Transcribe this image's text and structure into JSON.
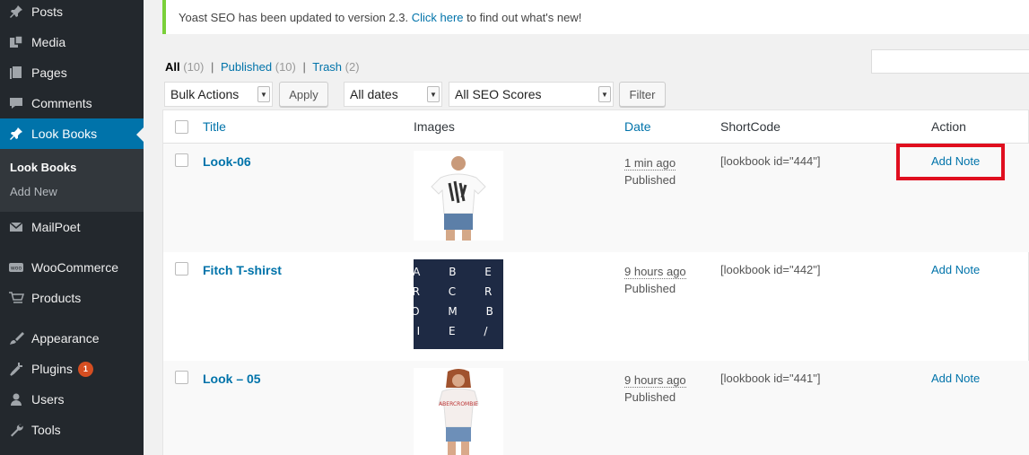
{
  "sidebar": {
    "items": [
      {
        "label": "Posts",
        "icon": "pin-icon"
      },
      {
        "label": "Media",
        "icon": "media-icon"
      },
      {
        "label": "Pages",
        "icon": "pages-icon"
      },
      {
        "label": "Comments",
        "icon": "comment-icon"
      },
      {
        "label": "Look Books",
        "icon": "pin-icon"
      },
      {
        "label": "MailPoet",
        "icon": "mail-icon"
      },
      {
        "label": "WooCommerce",
        "icon": "woo-icon"
      },
      {
        "label": "Products",
        "icon": "cart-icon"
      },
      {
        "label": "Appearance",
        "icon": "brush-icon"
      },
      {
        "label": "Plugins",
        "icon": "plug-icon",
        "badge": "1"
      },
      {
        "label": "Users",
        "icon": "user-icon"
      },
      {
        "label": "Tools",
        "icon": "wrench-icon"
      }
    ],
    "submenu": [
      {
        "label": "Look Books"
      },
      {
        "label": "Add New"
      }
    ],
    "accent": "#0073aa"
  },
  "notice": {
    "prefix": "Yoast SEO has been updated to version 2.3. ",
    "link": "Click here",
    "suffix": " to find out what's new!"
  },
  "views": {
    "all": "All",
    "all_count": "(10)",
    "published": "Published",
    "published_count": "(10)",
    "trash": "Trash",
    "trash_count": "(2)",
    "sep": "|"
  },
  "toolbar": {
    "bulk_actions": "Bulk Actions",
    "apply": "Apply",
    "all_dates": "All dates",
    "seo_scores": "All SEO Scores",
    "filter": "Filter"
  },
  "table": {
    "columns": {
      "title": "Title",
      "images": "Images",
      "date": "Date",
      "shortcode": "ShortCode",
      "action": "Action"
    },
    "rows": [
      {
        "title": "Look-06",
        "ago": "1 min ago",
        "status": "Published",
        "shortcode": "[lookbook id=\"444\"]",
        "action": "Add Note"
      },
      {
        "title": "Fitch T-shirst",
        "ago": "9 hours ago",
        "status": "Published",
        "shortcode": "[lookbook id=\"442\"]",
        "action": "Add Note"
      },
      {
        "title": "Look – 05",
        "ago": "9 hours ago",
        "status": "Published",
        "shortcode": "[lookbook id=\"441\"]",
        "action": "Add Note"
      }
    ],
    "shirt_letters": [
      "A B E",
      "R C R",
      "O M B",
      "I E /"
    ]
  }
}
